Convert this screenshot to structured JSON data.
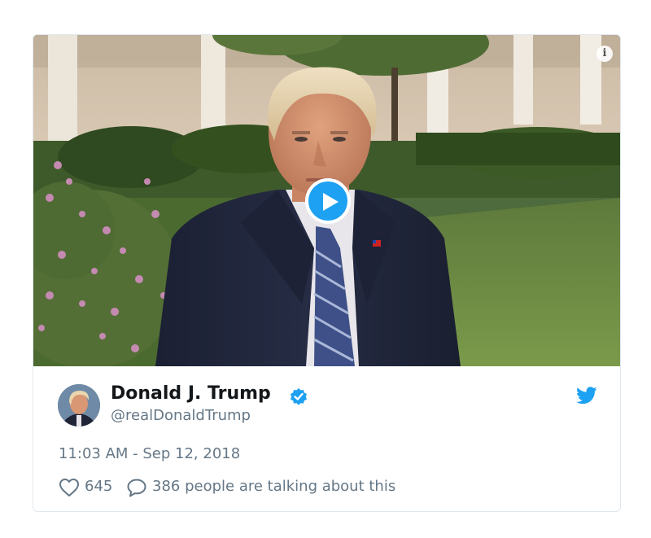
{
  "tweet": {
    "author_name": "Donald J. Trump",
    "author_handle": "@realDonaldTrump",
    "timestamp": "11:03 AM - Sep 12, 2018",
    "like_count": "645",
    "conversation_text": "386 people are talking about this",
    "verified": true
  },
  "icons": {
    "play": "play-icon",
    "info": "info-icon",
    "verified": "verified-badge-icon",
    "twitter": "twitter-bird-icon",
    "like": "heart-icon",
    "reply": "speech-bubble-icon"
  },
  "colors": {
    "accent": "#1da1f2",
    "text_primary": "#14171a",
    "text_secondary": "#657786",
    "border": "#e1e8ed"
  }
}
